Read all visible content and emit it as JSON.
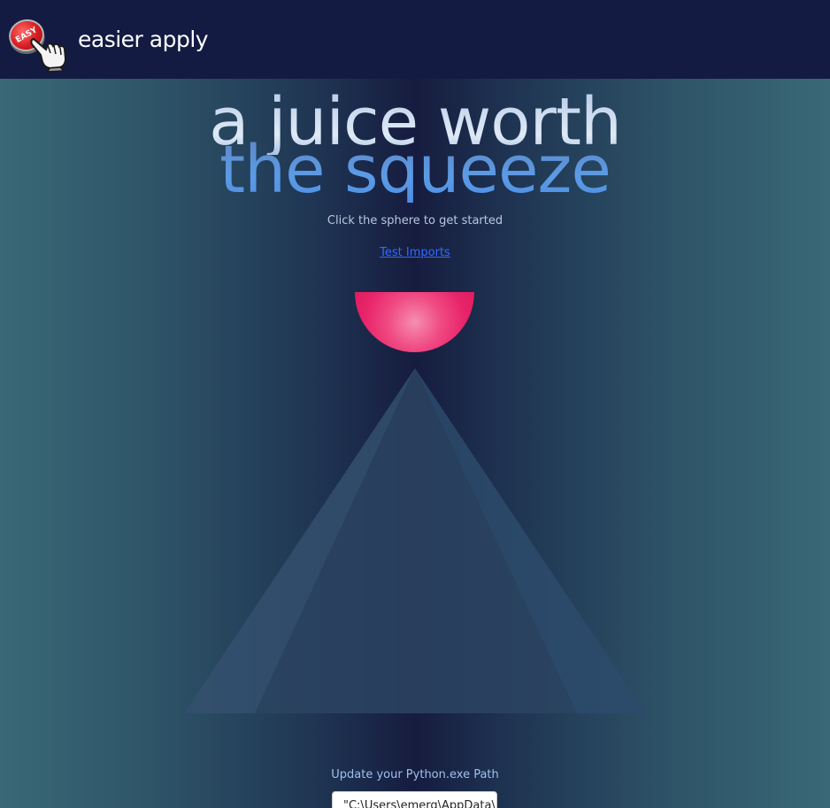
{
  "navbar": {
    "logo_text": "EASY",
    "brand": "easier apply"
  },
  "hero": {
    "title_line_1": "a juice worth",
    "title_line_2": "the squeeze",
    "subtitle": "Click the sphere to get started",
    "test_link": "Test Imports"
  },
  "python": {
    "label": "Update your Python.exe Path",
    "value": "\"C:\\Users\\emerg\\AppData\\"
  },
  "colors": {
    "navbar_bg": "#141b42",
    "sphere": "#e8246a",
    "link": "#2f6bff"
  },
  "icons": {
    "logo": "easy-button-hand-icon"
  }
}
